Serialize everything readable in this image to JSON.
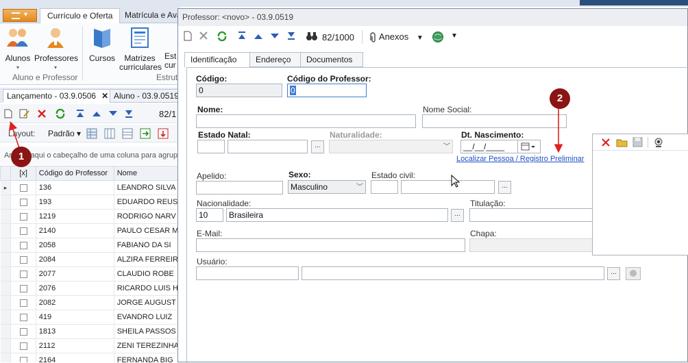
{
  "ribbon": {
    "tabs": [
      {
        "label": "Currículo e Oferta"
      },
      {
        "label": "Matrícula e Aval"
      }
    ],
    "buttons": [
      {
        "label": "Alunos"
      },
      {
        "label": "Professores"
      },
      {
        "label": "Cursos"
      },
      {
        "label": "Matrizes curriculares"
      },
      {
        "label": "Est cur"
      }
    ],
    "groups": [
      {
        "label": "Aluno e Professor"
      },
      {
        "label": "Estrutu"
      }
    ]
  },
  "doc_tabs": [
    {
      "label": "Lançamento - 03.9.0506",
      "close": "✕"
    },
    {
      "label": "Aluno - 03.9.0519"
    }
  ],
  "bg_toolbar": {
    "counter": "82/1"
  },
  "layout_bar": {
    "label": "Layout:",
    "value": "Padrão"
  },
  "group_hint": "Arraste aqui o cabeçalho de uma coluna para agrupar",
  "grid": {
    "columns": [
      "[x]",
      "Código do Professor",
      "Nome"
    ],
    "rows": [
      {
        "code": "136",
        "name": "LEANDRO SILVA"
      },
      {
        "code": "193",
        "name": "EDUARDO REUS"
      },
      {
        "code": "1219",
        "name": "RODRIGO NARV"
      },
      {
        "code": "2140",
        "name": "PAULO CESAR M"
      },
      {
        "code": "2058",
        "name": "FABIANO DA SI"
      },
      {
        "code": "2084",
        "name": "ALZIRA FERREIR"
      },
      {
        "code": "2077",
        "name": "CLAUDIO ROBE"
      },
      {
        "code": "2076",
        "name": "RICARDO LUIS H"
      },
      {
        "code": "2082",
        "name": "JORGE AUGUST"
      },
      {
        "code": "419",
        "name": "EVANDRO LUIZ"
      },
      {
        "code": "1813",
        "name": "SHEILA PASSOS"
      },
      {
        "code": "2112",
        "name": "ZENI TEREZINHA"
      },
      {
        "code": "2164",
        "name": "FERNANDA BIG"
      }
    ]
  },
  "dialog": {
    "title": "Professor: <novo> - 03.9.0519",
    "counter": "82/1000",
    "anexos": "Anexos",
    "tabs": [
      {
        "label": "Identificação"
      },
      {
        "label": "Endereço"
      },
      {
        "label": "Documentos"
      }
    ],
    "fields": {
      "codigo_label": "Código:",
      "codigo_value": "0",
      "cod_prof_label": "Código do Professor:",
      "cod_prof_value": "0",
      "nome_label": "Nome:",
      "nome_social_label": "Nome Social:",
      "estado_natal_label": "Estado Natal:",
      "naturalidade_label": "Naturalidade:",
      "dt_nasc_label": "Dt. Nascimento:",
      "dt_nasc_value": "__/__/____",
      "localizar_link": "Localizar Pessoa / Registro Preliminar",
      "apelido_label": "Apelido:",
      "sexo_label": "Sexo:",
      "sexo_value": "Masculino",
      "estado_civil_label": "Estado civil:",
      "nacionalidade_label": "Nacionalidade:",
      "nacionalidade_code": "10",
      "nacionalidade_value": "Brasileira",
      "titulacao_label": "Titulação:",
      "email_label": "E-Mail:",
      "chapa_label": "Chapa:",
      "usuario_label": "Usuário:",
      "ellipsis": "..."
    }
  },
  "annotations": [
    {
      "number": "1"
    },
    {
      "number": "2"
    }
  ],
  "colors": {
    "annotation": "#8b1414",
    "link": "#1d4fc4",
    "accent": "#3d7bd6"
  }
}
